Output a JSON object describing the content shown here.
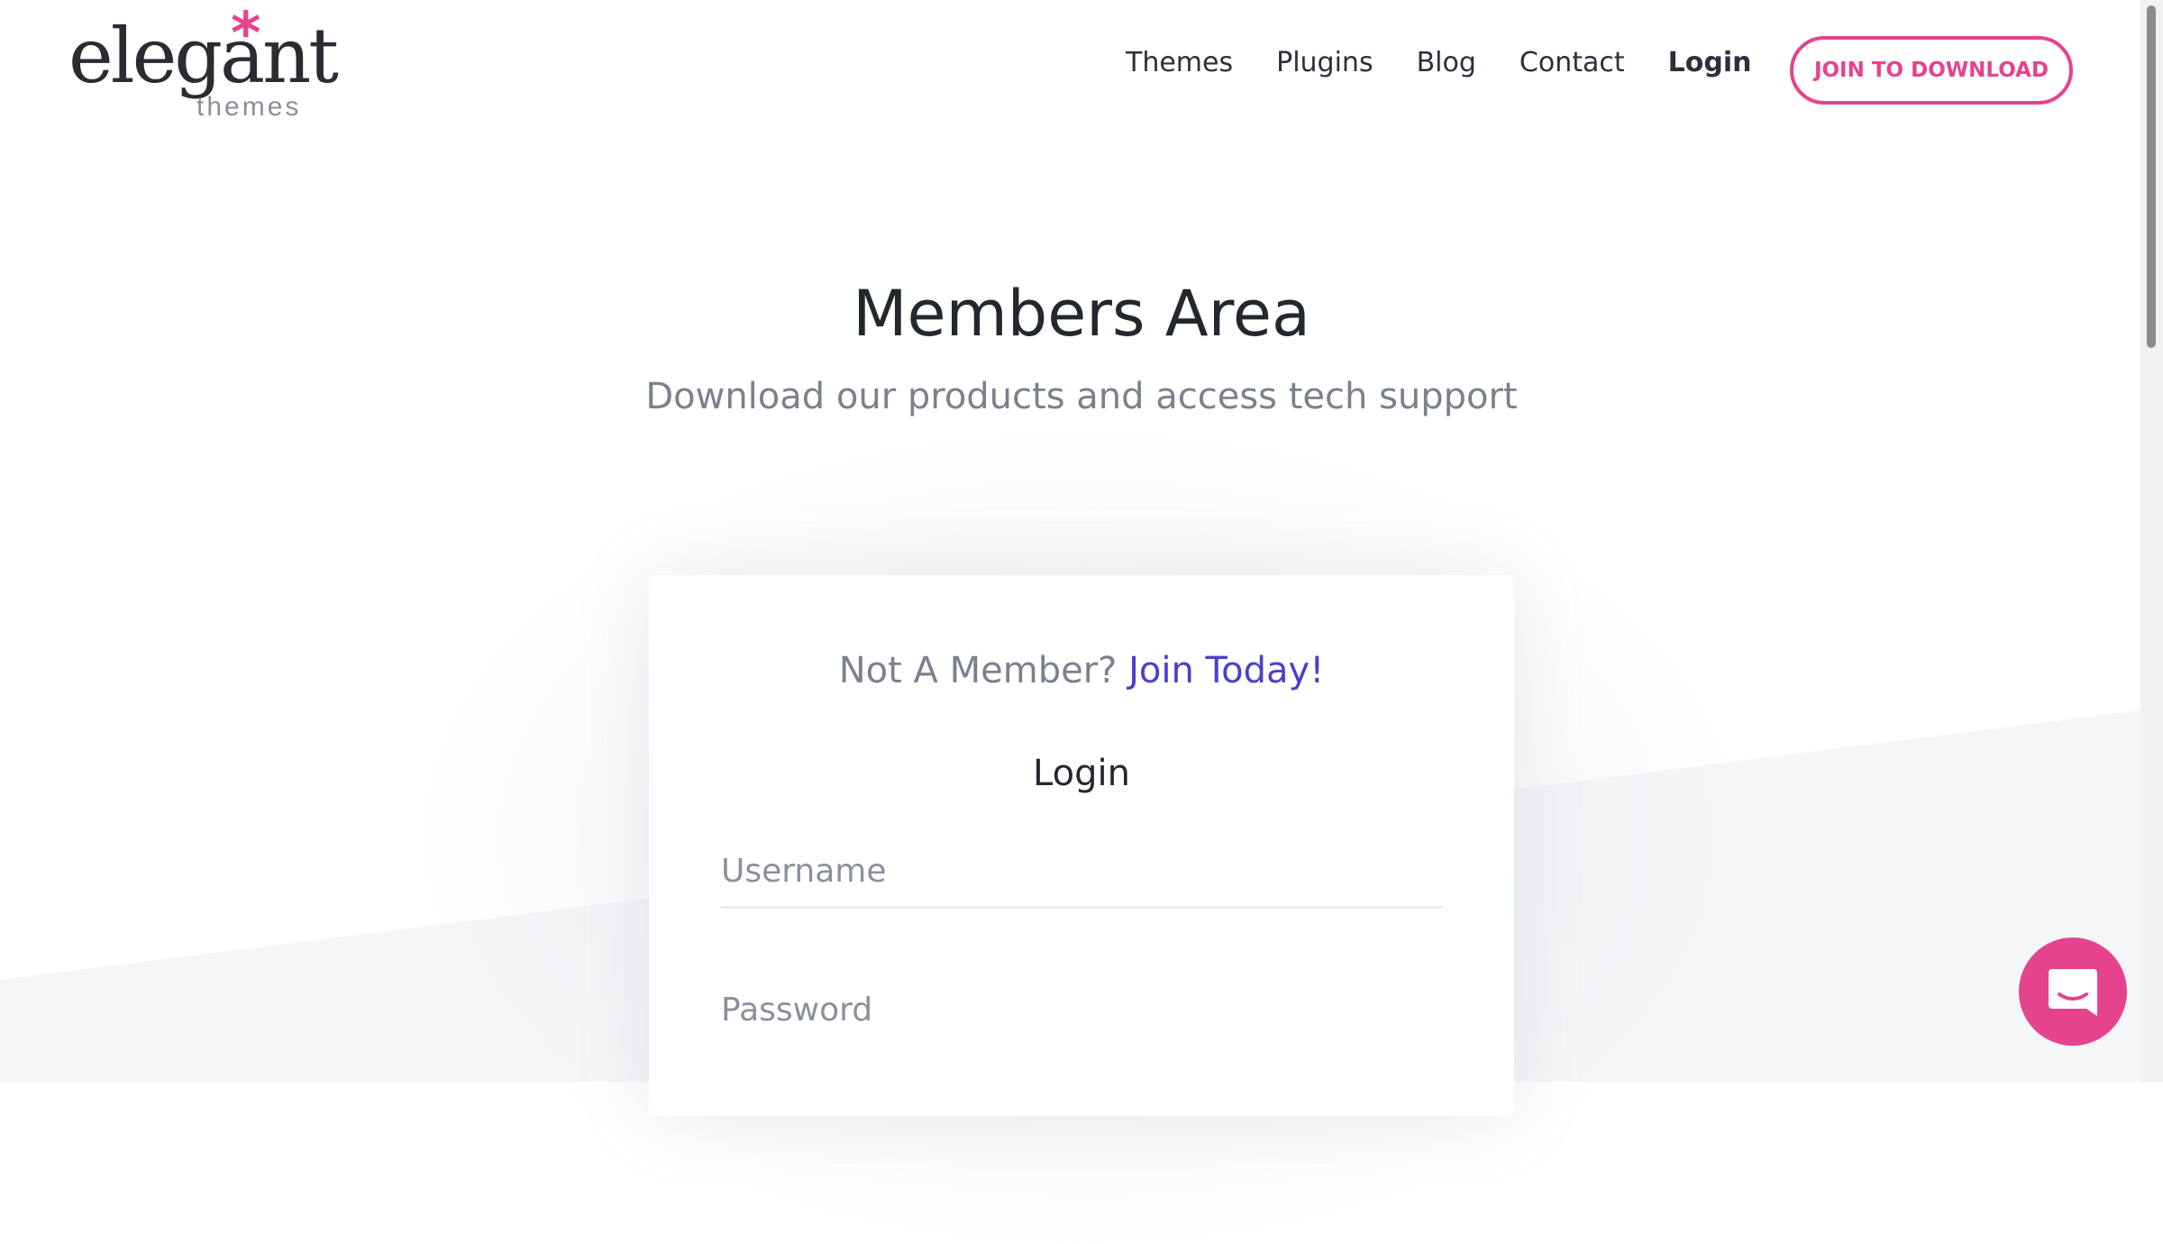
{
  "brand": {
    "logo_word": "elegant",
    "logo_sub": "themes",
    "accent_color": "#e5438e"
  },
  "nav": {
    "items": [
      {
        "label": "Themes",
        "bold": false
      },
      {
        "label": "Plugins",
        "bold": false
      },
      {
        "label": "Blog",
        "bold": false
      },
      {
        "label": "Contact",
        "bold": false
      },
      {
        "label": "Login",
        "bold": true
      }
    ],
    "cta_label": "JOIN TO DOWNLOAD"
  },
  "hero": {
    "title": "Members Area",
    "subtitle": "Download our products and access tech support"
  },
  "login_card": {
    "prompt_text": "Not A Member?",
    "prompt_link": "Join Today!",
    "heading": "Login",
    "username_placeholder": "Username",
    "password_placeholder": "Password",
    "link_color": "#4a3fcc"
  },
  "chat": {
    "icon": "chat-icon"
  }
}
